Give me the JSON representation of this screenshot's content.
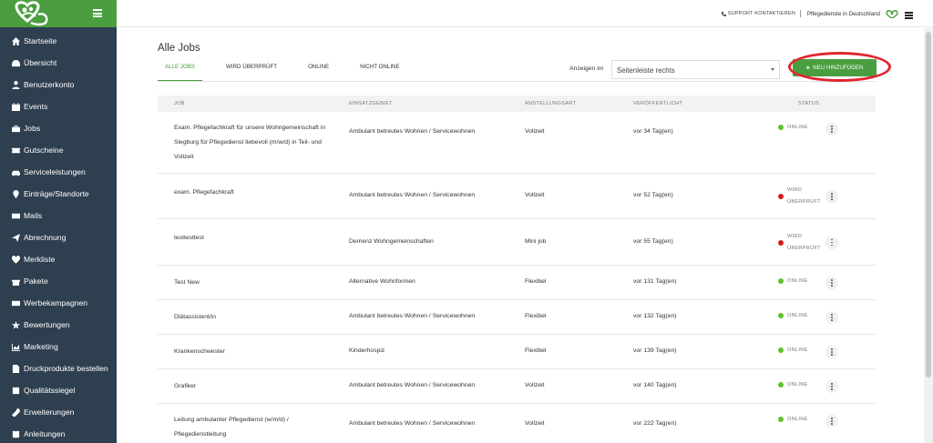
{
  "topbar": {
    "support_label": "SUPPORT KONTAKTIEREN",
    "brand_label": "Pflegedienste in Deutschland"
  },
  "sidebar": {
    "items": [
      {
        "label": "Startseite",
        "icon": "home-icon"
      },
      {
        "label": "Übersicht",
        "icon": "dashboard-icon"
      },
      {
        "label": "Benutzerkonto",
        "icon": "user-icon"
      },
      {
        "label": "Events",
        "icon": "calendar-icon"
      },
      {
        "label": "Jobs",
        "icon": "briefcase-icon"
      },
      {
        "label": "Gutscheine",
        "icon": "ticket-icon"
      },
      {
        "label": "Serviceleistungen",
        "icon": "car-icon"
      },
      {
        "label": "Einträge/Standorte",
        "icon": "map-marker-icon"
      },
      {
        "label": "Mails",
        "icon": "envelope-icon"
      },
      {
        "label": "Abrechnung",
        "icon": "paper-plane-icon"
      },
      {
        "label": "Merkliste",
        "icon": "heart-icon"
      },
      {
        "label": "Pakete",
        "icon": "gift-icon"
      },
      {
        "label": "Werbekampagnen",
        "icon": "mail-icon"
      },
      {
        "label": "Bewertungen",
        "icon": "star-icon"
      },
      {
        "label": "Marketing",
        "icon": "chart-icon"
      },
      {
        "label": "Druckprodukte bestellen",
        "icon": "file-icon"
      },
      {
        "label": "Qualitätssiegel",
        "icon": "seal-icon"
      },
      {
        "label": "Erweiterungen",
        "icon": "wrench-icon"
      },
      {
        "label": "Anleitungen",
        "icon": "book-icon"
      }
    ]
  },
  "main": {
    "title": "Alle Jobs",
    "tabs": [
      {
        "label": "ALLE JOBS",
        "active": true
      },
      {
        "label": "WIRD ÜBERPRÜFT",
        "active": false
      },
      {
        "label": "ONLINE",
        "active": false
      },
      {
        "label": "NICHT ONLINE",
        "active": false
      }
    ],
    "filter_label": "Anzeigen im",
    "filter_value": "Seitenleiste rechts",
    "add_button_label": "NEU HINZUFÜGEN"
  },
  "table": {
    "columns": [
      "JOB",
      "EINSATZGEBIET",
      "ANSTELLUNGSART",
      "VERÖFFENTLICHT",
      "STATUS"
    ],
    "rows": [
      {
        "job": "Exam. Pflegefachkraft für unsere Wohngemeinschaft in Siegburg für Pflegedienst liebevoll (m/w/d) in Teil- und Vollzeit",
        "area": "Ambulant betreutes Wohnen / Servicewohnen",
        "type": "Vollzeit",
        "age": "vor 34 Tag(en)",
        "status": "ONLINE",
        "status_color": "#5ec22a"
      },
      {
        "job": "exam. Pflegefachkraft",
        "area": "Ambulant betreutes Wohnen / Servicewohnen",
        "type": "Vollzeit",
        "age": "vor 52 Tag(en)",
        "status_line1": "WIRD",
        "status_line2": "ÜBERPRÜFT",
        "status_color": "#d61b1b"
      },
      {
        "job": "testtesttest",
        "area": "Demenz Wohngemeinschaften",
        "type": "Mini job",
        "age": "vor 55 Tag(en)",
        "status_line1": "WIRD",
        "status_line2": "ÜBERPRÜFT",
        "status_color": "#d61b1b"
      },
      {
        "job": "Test New",
        "area": "Alternative Wohnformen",
        "type": "Flexibel",
        "age": "vor 131 Tag(en)",
        "status": "ONLINE",
        "status_color": "#5ec22a"
      },
      {
        "job": "Diätassistent/in",
        "area": "Ambulant betreutes Wohnen / Servicewohnen",
        "type": "Flexibel",
        "age": "vor 132 Tag(en)",
        "status": "ONLINE",
        "status_color": "#5ec22a"
      },
      {
        "job": "Krankenschwester",
        "area": "Kinderhospiz",
        "type": "Flexibel",
        "age": "vor 139 Tag(en)",
        "status": "ONLINE",
        "status_color": "#5ec22a"
      },
      {
        "job": "Grafiker",
        "area": "Ambulant betreutes Wohnen / Servicewohnen",
        "type": "Vollzeit",
        "age": "vor 140 Tag(en)",
        "status": "ONLINE",
        "status_color": "#5ec22a"
      },
      {
        "job": "Leitung ambulanter Pflegedienst (w/m/d) / Pflegedienstleitung",
        "area": "Ambulant betreutes Wohnen / Servicewohnen",
        "type": "Vollzeit",
        "age": "vor 222 Tag(en)",
        "status": "ONLINE",
        "status_color": "#5ec22a"
      }
    ]
  },
  "colors": {
    "sidebar_bg": "#2e3f4f",
    "brand_green": "#4a9e3f",
    "highlight_red": "#e0262e"
  }
}
